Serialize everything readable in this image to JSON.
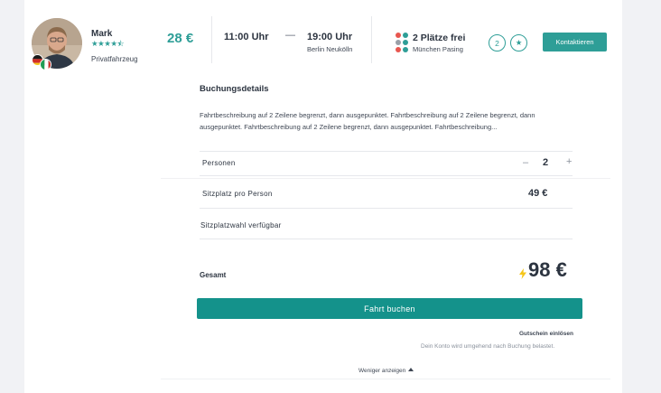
{
  "driver": {
    "name": "Mark",
    "rating": 4.5,
    "stars": "★★★★⯪",
    "vehicle": "Privatfahrzeug",
    "flags": [
      "flag-germany-icon",
      "flag-italy-icon"
    ]
  },
  "trip": {
    "price": "28 €",
    "departure_time": "11:00 Uhr",
    "separator": "—",
    "arrival_time": "19:00 Uhr",
    "arrival_place": "Berlin Neukölln",
    "seats_free": "2 Plätze frei",
    "seats_place": "München Pasing",
    "badge_count": "2",
    "badge_star": "★",
    "contact_label": "Kontaktieren"
  },
  "booking": {
    "title": "Buchungsdetails",
    "description": "Fahrtbeschreibung auf 2 Zeilene begrenzt, dann ausgepunktet. Fahrtbeschreibung auf 2 Zeilene begrenzt, dann ausgepunktet. Fahrtbeschreibung auf 2 Zeilene begrenzt, dann ausgepunktet. Fahrtbeschreibung...",
    "persons_label": "Personen",
    "minus": "–",
    "persons_value": "2",
    "plus": "+",
    "seat_price_label": "Sitzplatz pro Person",
    "seat_price_value": "49 €",
    "seat_selection_label": "Sitzplatzwahl verfügbar",
    "total_label": "Gesamt",
    "total_value": "98 €",
    "book_label": "Fahrt buchen",
    "voucher_label": "Gutschein einlösen",
    "account_note": "Dein Konto wird umgehend nach Buchung belastet.",
    "show_less_label": "Weniger anzeigen"
  },
  "colors": {
    "accent": "#2e9e97",
    "button": "#14928b",
    "text": "#2c3440",
    "bolt": "#f5c518"
  }
}
